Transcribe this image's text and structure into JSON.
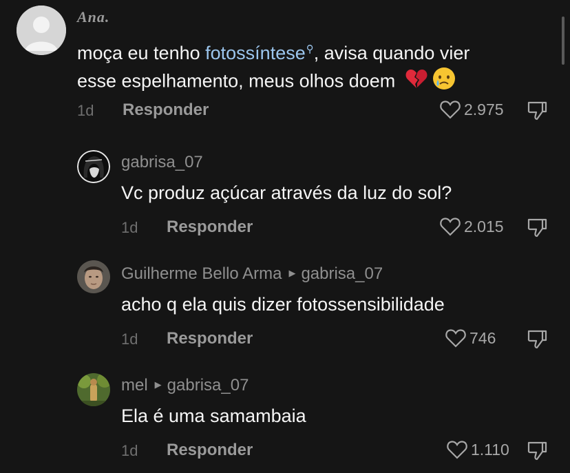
{
  "comments": [
    {
      "username": "Ana.",
      "text_before": "moça eu tenho ",
      "link": "fotossíntese",
      "text_line1_after": ", avisa quando vier",
      "text_line2": "esse espelhamento, meus olhos doem",
      "emojis": [
        "broken-heart",
        "crying-face"
      ],
      "time": "1d",
      "reply_label": "Responder",
      "likes": "2.975"
    },
    {
      "username": "gabrisa_07",
      "text": "Vc produz açúcar através da luz do sol?",
      "time": "1d",
      "reply_label": "Responder",
      "likes": "2.015"
    },
    {
      "username": "Guilherme Bello Arma",
      "reply_to": "gabrisa_07",
      "text": "acho q ela quis dizer fotossensibilidade",
      "time": "1d",
      "reply_label": "Responder",
      "likes": "746"
    },
    {
      "username": "mel",
      "reply_to": "gabrisa_07",
      "text": "Ela é uma samambaia",
      "time": "1d",
      "reply_label": "Responder",
      "likes": "1.110"
    }
  ],
  "colors": {
    "background": "#151515",
    "link": "#9cc6ee",
    "muted": "#8f8f8f"
  }
}
